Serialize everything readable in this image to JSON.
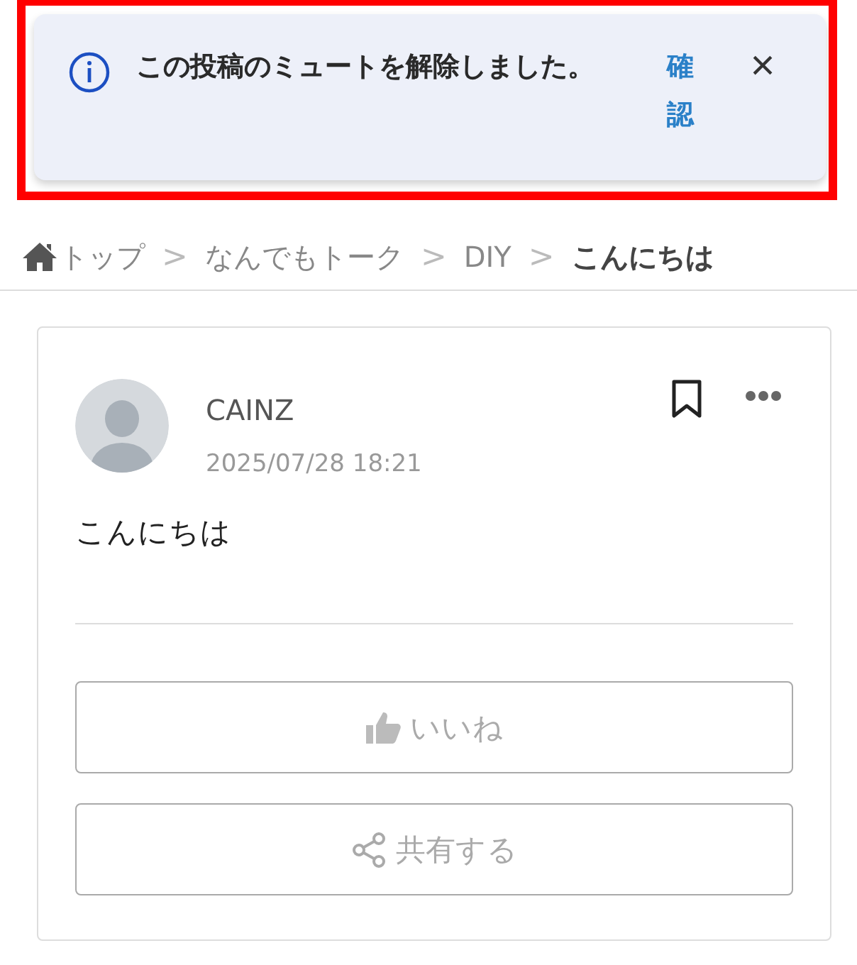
{
  "toast": {
    "message": "この投稿のミュートを解除しました。",
    "action": "確認",
    "close": "×"
  },
  "breadcrumb": {
    "items": [
      "トップ",
      "なんでもトーク",
      "DIY"
    ],
    "separator": ">",
    "current": "こんにちは"
  },
  "post": {
    "author": "CAINZ",
    "date": "2025/07/28 18:21",
    "body": "こんにちは",
    "buttons": [
      {
        "kind": "like",
        "label": "いいね"
      },
      {
        "kind": "share",
        "label": "共有する"
      }
    ]
  }
}
